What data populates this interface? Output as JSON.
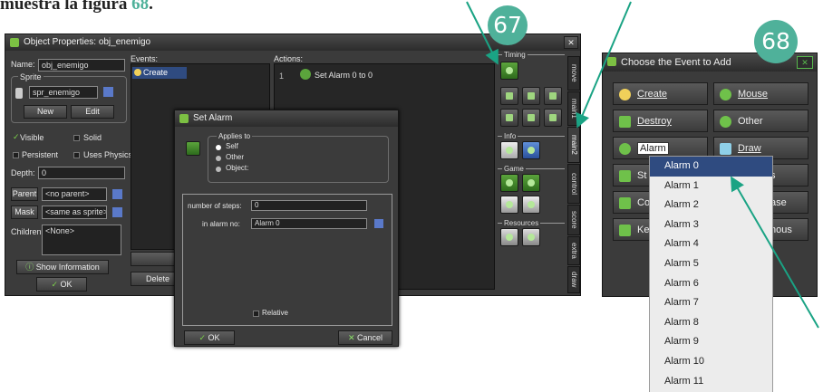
{
  "caption": {
    "text": "muestra la figura ",
    "num": "68",
    "end": "."
  },
  "badges": {
    "left": "67",
    "right": "68"
  },
  "props": {
    "title": "Object Properties: obj_enemigo",
    "name_label": "Name:",
    "name_value": "obj_enemigo",
    "sprite_label": "Sprite",
    "sprite_value": "spr_enemigo",
    "new_btn": "New",
    "edit_btn": "Edit",
    "visible": "Visible",
    "solid": "Solid",
    "persistent": "Persistent",
    "physics": "Uses Physics",
    "depth_label": "Depth:",
    "depth_value": "0",
    "parent_btn": "Parent",
    "parent_value": "<no parent>",
    "mask_btn": "Mask",
    "mask_value": "<same as sprite>",
    "children_label": "Children",
    "children_value": "<None>",
    "show_info": "Show Information",
    "ok": "OK",
    "events_label": "Events:",
    "event_create": "Create",
    "delete_btn": "Delete",
    "actions_label": "Actions:",
    "action_num": "1",
    "action_text": "Set Alarm 0 to 0",
    "sections": {
      "timing": "Timing",
      "info": "Info",
      "game": "Game",
      "resources": "Resources"
    },
    "tabs": [
      "move",
      "main1",
      "main2",
      "control",
      "score",
      "extra",
      "draw"
    ]
  },
  "alarm": {
    "title": "Set Alarm",
    "applies_to": "Applies to",
    "self": "Self",
    "other": "Other",
    "object": "Object:",
    "steps_label": "number of steps:",
    "steps_value": "0",
    "alarmno_label": "in alarm no:",
    "alarmno_value": "Alarm 0",
    "relative": "Relative",
    "ok": "OK",
    "cancel": "Cancel"
  },
  "events": {
    "title": "Choose the Event to Add",
    "create": "Create",
    "mouse": "Mouse",
    "destroy": "Destroy",
    "other": "Other",
    "alarm": "Alarm",
    "draw": "Draw",
    "step_partial": "St",
    "s_partial": "s",
    "coll_partial": "Co",
    "ase_partial": "ase",
    "key_partial": "Ke",
    "ous_partial": "nous",
    "dropdown": [
      "Alarm 0",
      "Alarm 1",
      "Alarm 2",
      "Alarm 3",
      "Alarm 4",
      "Alarm 5",
      "Alarm 6",
      "Alarm 7",
      "Alarm 8",
      "Alarm 9",
      "Alarm 10",
      "Alarm 11"
    ],
    "selected_index": 0
  },
  "colors": {
    "accent": "#4fb19a",
    "window": "#3b3b3b",
    "selection": "#2f4b80"
  },
  "icons": [
    "lightbulb-icon",
    "alarm-clock-icon",
    "trash-icon",
    "mouse-icon",
    "draw-icon",
    "info-icon"
  ]
}
